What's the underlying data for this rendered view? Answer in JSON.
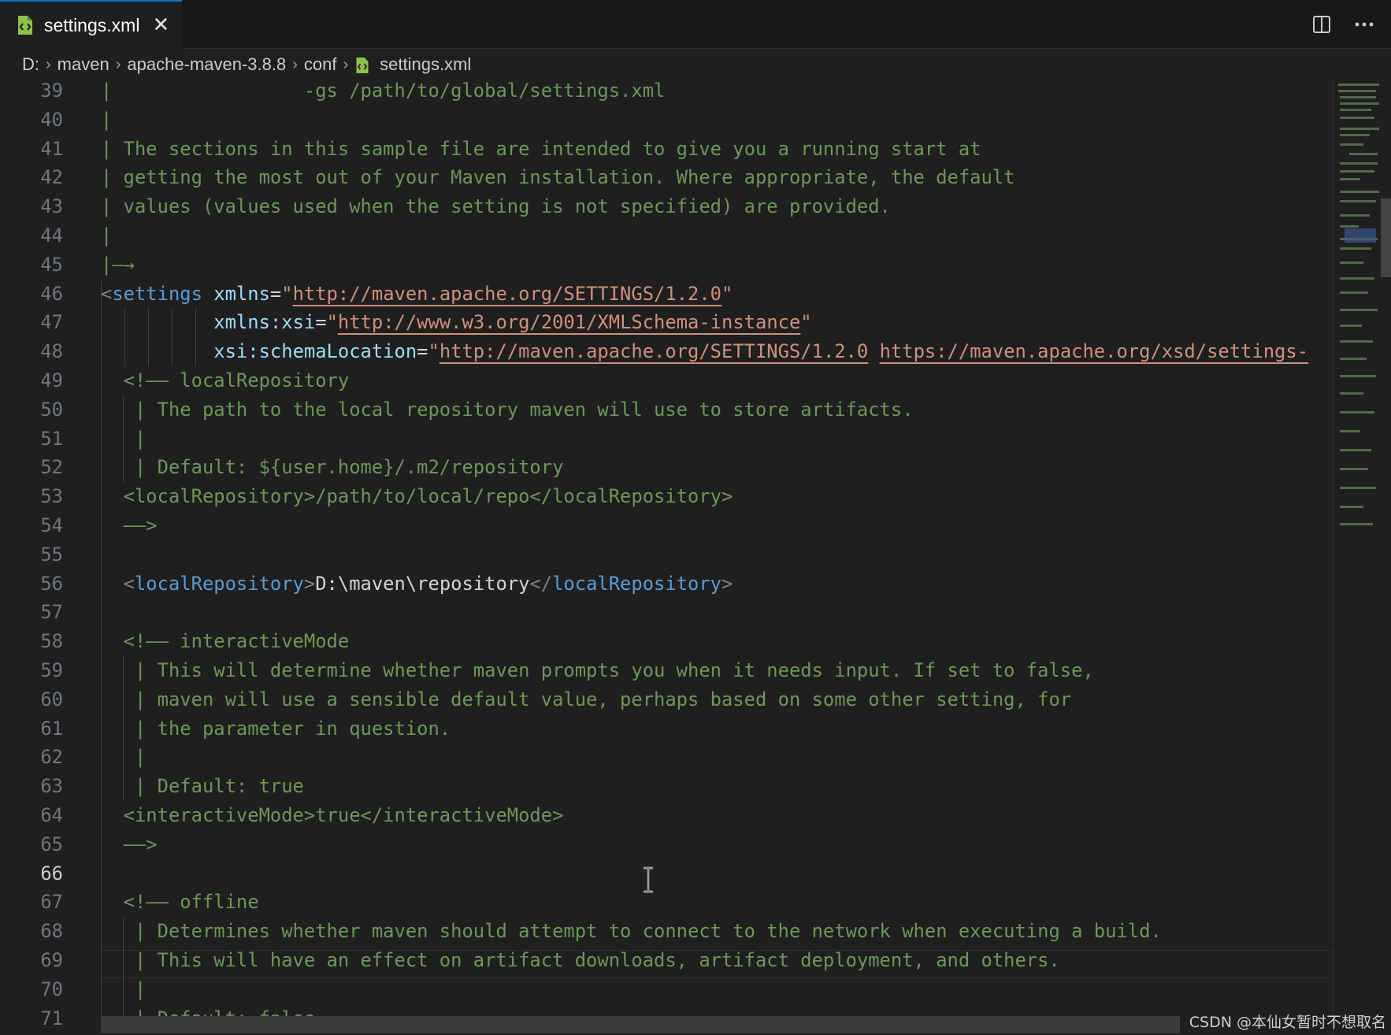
{
  "tab": {
    "label": "settings.xml",
    "close_glyph": "✕"
  },
  "toolbar": {
    "split_icon": "split-editor-icon",
    "more_glyph": "···"
  },
  "breadcrumb": {
    "items": [
      "D:",
      "maven",
      "apache-maven-3.8.8",
      "conf",
      "settings.xml"
    ],
    "separator": "›"
  },
  "editor": {
    "active_line": "66",
    "lines": [
      {
        "n": "39",
        "parts": [
          {
            "t": "|                 -gs /path/to/global/settings.xml",
            "c": "com"
          }
        ]
      },
      {
        "n": "40",
        "parts": [
          {
            "t": "|",
            "c": "com"
          }
        ]
      },
      {
        "n": "41",
        "parts": [
          {
            "t": "| The sections in this sample file are intended to give you a running start at",
            "c": "com"
          }
        ]
      },
      {
        "n": "42",
        "parts": [
          {
            "t": "| getting the most out of your Maven installation. Where appropriate, the default",
            "c": "com"
          }
        ]
      },
      {
        "n": "43",
        "parts": [
          {
            "t": "| values (values used when the setting is not specified) are provided.",
            "c": "com"
          }
        ]
      },
      {
        "n": "44",
        "parts": [
          {
            "t": "|",
            "c": "com"
          }
        ]
      },
      {
        "n": "45",
        "parts": [
          {
            "t": "|—→",
            "c": "com"
          }
        ]
      },
      {
        "n": "46",
        "parts": [
          {
            "t": "<",
            "c": "br"
          },
          {
            "t": "settings",
            "c": "tag"
          },
          {
            "t": " ",
            "c": "txt"
          },
          {
            "t": "xmlns",
            "c": "attr"
          },
          {
            "t": "=",
            "c": "txt"
          },
          {
            "t": "\"",
            "c": "str"
          },
          {
            "t": "http://maven.apache.org/SETTINGS/1.2.0",
            "c": "url"
          },
          {
            "t": "\"",
            "c": "str"
          }
        ]
      },
      {
        "n": "47",
        "parts": [
          {
            "t": "          ",
            "c": "txt"
          },
          {
            "t": "xmlns:xsi",
            "c": "attr"
          },
          {
            "t": "=",
            "c": "txt"
          },
          {
            "t": "\"",
            "c": "str"
          },
          {
            "t": "http://www.w3.org/2001/XMLSchema-instance",
            "c": "url"
          },
          {
            "t": "\"",
            "c": "str"
          }
        ]
      },
      {
        "n": "48",
        "parts": [
          {
            "t": "          ",
            "c": "txt"
          },
          {
            "t": "xsi:schemaLocation",
            "c": "attr"
          },
          {
            "t": "=",
            "c": "txt"
          },
          {
            "t": "\"",
            "c": "str"
          },
          {
            "t": "http://maven.apache.org/SETTINGS/1.2.0",
            "c": "url"
          },
          {
            "t": " ",
            "c": "str"
          },
          {
            "t": "https://maven.apache.org/xsd/settings-",
            "c": "url"
          }
        ]
      },
      {
        "n": "49",
        "parts": [
          {
            "t": "  <!—— localRepository",
            "c": "com"
          }
        ]
      },
      {
        "n": "50",
        "parts": [
          {
            "t": "   | The path to the local repository maven will use to store artifacts.",
            "c": "com"
          }
        ]
      },
      {
        "n": "51",
        "parts": [
          {
            "t": "   |",
            "c": "com"
          }
        ]
      },
      {
        "n": "52",
        "parts": [
          {
            "t": "   | Default: ${user.home}/.m2/repository",
            "c": "com"
          }
        ]
      },
      {
        "n": "53",
        "parts": [
          {
            "t": "  <localRepository>/path/to/local/repo</localRepository>",
            "c": "com"
          }
        ]
      },
      {
        "n": "54",
        "parts": [
          {
            "t": "  ——>",
            "c": "com"
          }
        ]
      },
      {
        "n": "55",
        "parts": []
      },
      {
        "n": "56",
        "parts": [
          {
            "t": "  <",
            "c": "br"
          },
          {
            "t": "localRepository",
            "c": "tag"
          },
          {
            "t": ">",
            "c": "br"
          },
          {
            "t": "D:\\maven\\repository",
            "c": "txt"
          },
          {
            "t": "</",
            "c": "br"
          },
          {
            "t": "localRepository",
            "c": "tag"
          },
          {
            "t": ">",
            "c": "br"
          }
        ]
      },
      {
        "n": "57",
        "parts": []
      },
      {
        "n": "58",
        "parts": [
          {
            "t": "  <!—— interactiveMode",
            "c": "com"
          }
        ]
      },
      {
        "n": "59",
        "parts": [
          {
            "t": "   | This will determine whether maven prompts you when it needs input. If set to false,",
            "c": "com"
          }
        ]
      },
      {
        "n": "60",
        "parts": [
          {
            "t": "   | maven will use a sensible default value, perhaps based on some other setting, for",
            "c": "com"
          }
        ]
      },
      {
        "n": "61",
        "parts": [
          {
            "t": "   | the parameter in question.",
            "c": "com"
          }
        ]
      },
      {
        "n": "62",
        "parts": [
          {
            "t": "   |",
            "c": "com"
          }
        ]
      },
      {
        "n": "63",
        "parts": [
          {
            "t": "   | Default: true",
            "c": "com"
          }
        ]
      },
      {
        "n": "64",
        "parts": [
          {
            "t": "  <interactiveMode>true</interactiveMode>",
            "c": "com"
          }
        ]
      },
      {
        "n": "65",
        "parts": [
          {
            "t": "  ——>",
            "c": "com"
          }
        ]
      },
      {
        "n": "66",
        "parts": []
      },
      {
        "n": "67",
        "parts": [
          {
            "t": "  <!—— offline",
            "c": "com"
          }
        ]
      },
      {
        "n": "68",
        "parts": [
          {
            "t": "   | Determines whether maven should attempt to connect to the network when executing a build.",
            "c": "com"
          }
        ]
      },
      {
        "n": "69",
        "parts": [
          {
            "t": "   | This will have an effect on artifact downloads, artifact deployment, and others.",
            "c": "com"
          }
        ]
      },
      {
        "n": "70",
        "parts": [
          {
            "t": "   |",
            "c": "com"
          }
        ]
      },
      {
        "n": "71",
        "parts": [
          {
            "t": "   | Default: false",
            "c": "com"
          }
        ]
      }
    ]
  },
  "watermark": "CSDN @本仙女暂时不想取名",
  "colors": {
    "accent": "#0078d4",
    "comment": "#6a9955",
    "tag": "#569cd6",
    "attribute": "#9cdcfe",
    "string": "#ce9178",
    "xml_file_icon": "#8dc149"
  }
}
